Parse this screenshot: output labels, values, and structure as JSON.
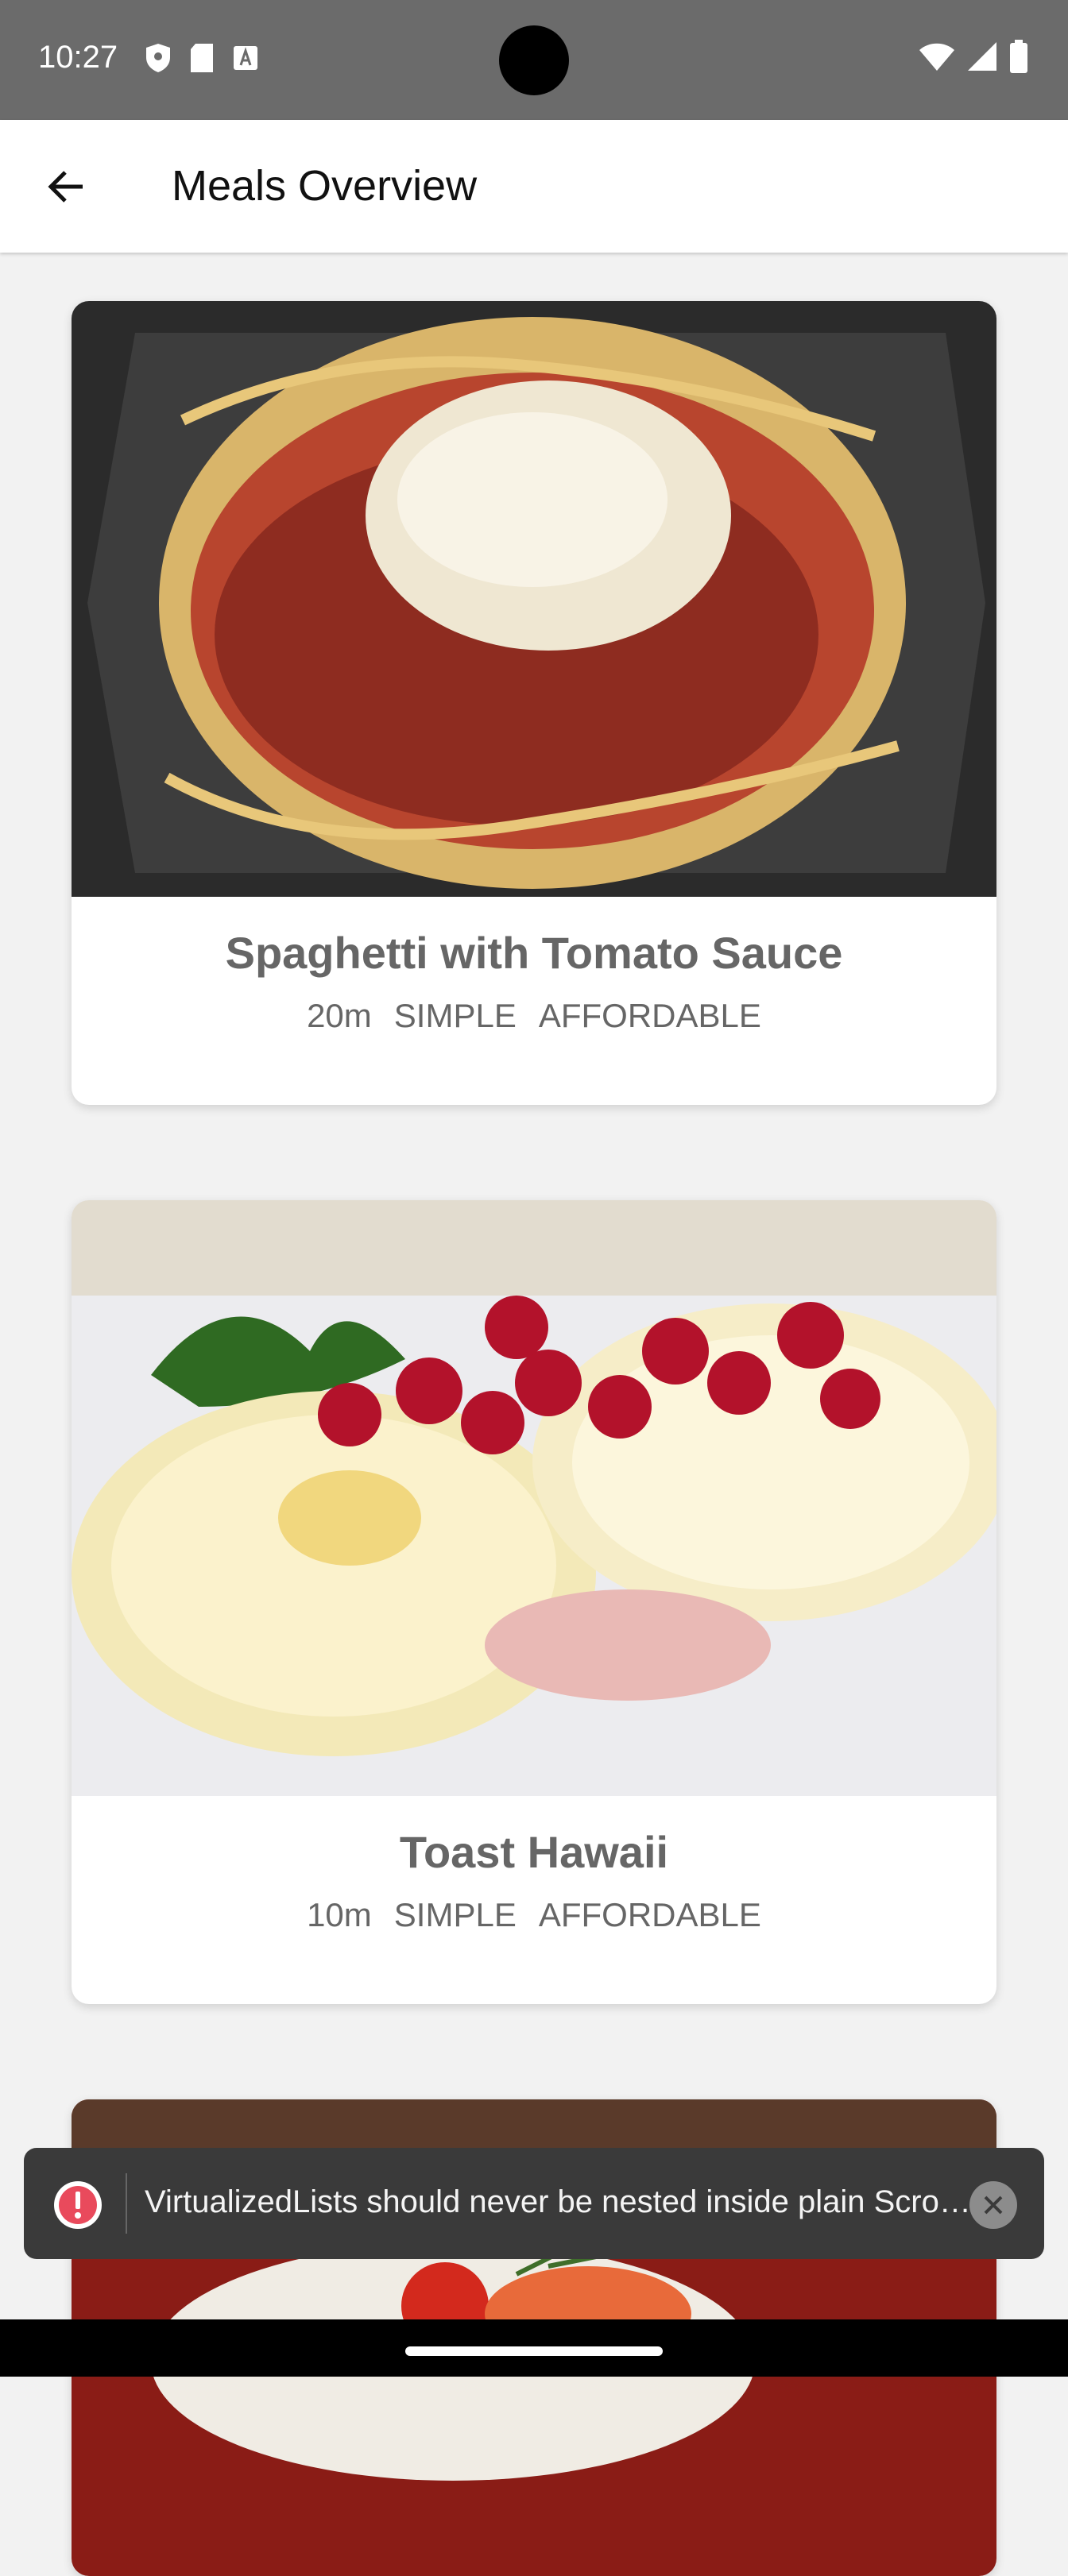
{
  "status_bar": {
    "time": "10:27"
  },
  "header": {
    "title": "Meals Overview",
    "back_icon": "arrow-left-icon"
  },
  "meals": [
    {
      "title": "Spaghetti with Tomato Sauce",
      "duration": "20m",
      "complexity": "SIMPLE",
      "affordability": "AFFORDABLE"
    },
    {
      "title": "Toast Hawaii",
      "duration": "10m",
      "complexity": "SIMPLE",
      "affordability": "AFFORDABLE"
    }
  ],
  "toast": {
    "message": "VirtualizedLists should never be nested inside plain ScrollViews with the same orientation",
    "icon": "error-exclamation-icon",
    "accent_color": "#e94a5c"
  }
}
